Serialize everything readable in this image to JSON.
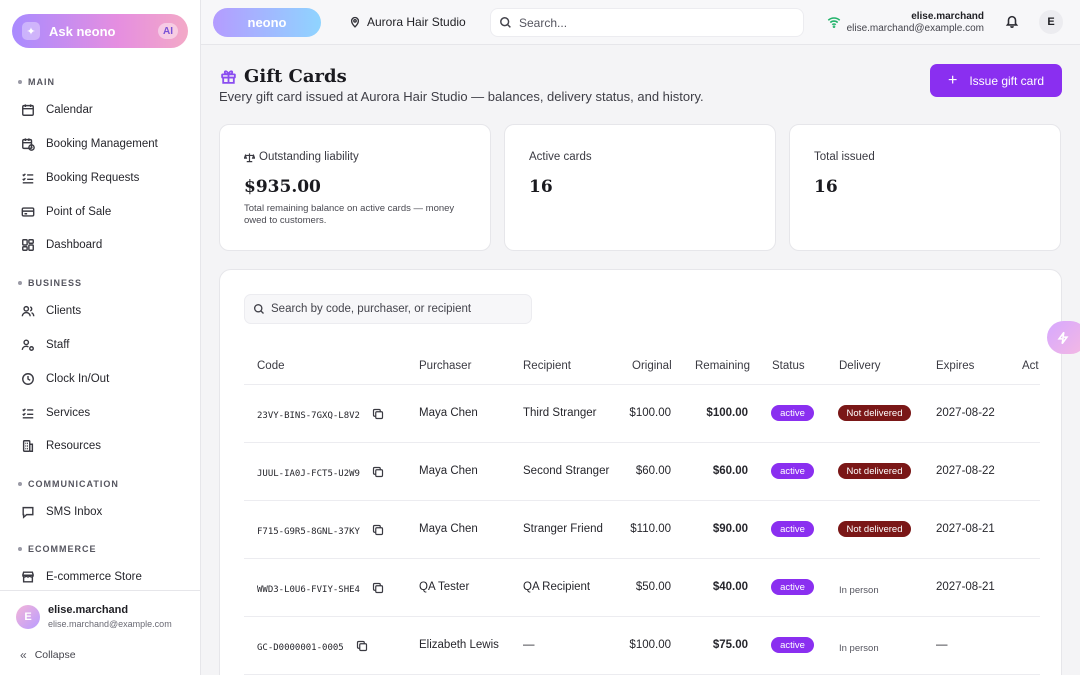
{
  "sidebar": {
    "ask": {
      "label": "Ask neono",
      "badge": "AI"
    },
    "sections": [
      {
        "label": "MAIN"
      },
      {
        "label": "BUSINESS"
      },
      {
        "label": "COMMUNICATION"
      },
      {
        "label": "ECOMMERCE"
      }
    ],
    "items": [
      {
        "label": "Calendar",
        "icon": "calendar-icon"
      },
      {
        "label": "Booking Management",
        "icon": "calendar-clock-icon"
      },
      {
        "label": "Booking Requests",
        "icon": "list-check-icon"
      },
      {
        "label": "Point of Sale",
        "icon": "credit-card-icon"
      },
      {
        "label": "Dashboard",
        "icon": "grid-icon"
      },
      {
        "label": "Clients",
        "icon": "users-icon"
      },
      {
        "label": "Staff",
        "icon": "staff-icon"
      },
      {
        "label": "Clock In/Out",
        "icon": "clock-icon"
      },
      {
        "label": "Services",
        "icon": "list-icon"
      },
      {
        "label": "Resources",
        "icon": "building-icon"
      },
      {
        "label": "SMS Inbox",
        "icon": "message-icon"
      },
      {
        "label": "E-commerce Store",
        "icon": "store-icon"
      }
    ],
    "user": {
      "initial": "E",
      "name": "elise.marchand",
      "email": "elise.marchand@example.com"
    },
    "collapse_label": "Collapse"
  },
  "topbar": {
    "logo": "neono",
    "studio": "Aurora Hair Studio",
    "search_placeholder": "Search...",
    "user_name": "elise.marchand",
    "user_email": "elise.marchand@example.com",
    "avatar_initial": "E"
  },
  "page": {
    "title": "Gift Cards",
    "subtitle": "Every gift card issued at Aurora Hair Studio — balances, delivery status, and history.",
    "issue_button": "Issue gift card"
  },
  "stats": [
    {
      "label": "Outstanding liability",
      "value": "$935.00",
      "note": "Total remaining balance on active cards — money owed to customers."
    },
    {
      "label": "Active cards",
      "value": "16"
    },
    {
      "label": "Total issued",
      "value": "16"
    }
  ],
  "table": {
    "search_placeholder": "Search by code, purchaser, or recipient",
    "columns": [
      "Code",
      "Purchaser",
      "Recipient",
      "Original",
      "Remaining",
      "Status",
      "Delivery",
      "Expires",
      "Act"
    ],
    "rows": [
      {
        "code": "23VY-BINS-7GXQ-L8V2",
        "purchaser": "Maya Chen",
        "recipient": "Third Stranger",
        "original": "$100.00",
        "remaining": "$100.00",
        "status": "active",
        "delivery": "Not delivered",
        "expires": "2027-08-22"
      },
      {
        "code": "JUUL-IA0J-FCT5-U2W9",
        "purchaser": "Maya Chen",
        "recipient": "Second Stranger",
        "original": "$60.00",
        "remaining": "$60.00",
        "status": "active",
        "delivery": "Not delivered",
        "expires": "2027-08-22"
      },
      {
        "code": "F715-G9R5-8GNL-37KY",
        "purchaser": "Maya Chen",
        "recipient": "Stranger Friend",
        "original": "$110.00",
        "remaining": "$90.00",
        "status": "active",
        "delivery": "Not delivered",
        "expires": "2027-08-21"
      },
      {
        "code": "WWD3-L0U6-FVIY-SHE4",
        "purchaser": "QA Tester",
        "recipient": "QA Recipient",
        "original": "$50.00",
        "remaining": "$40.00",
        "status": "active",
        "delivery": "In person",
        "expires": "2027-08-21"
      },
      {
        "code": "GC-D0000001-0005",
        "purchaser": "Elizabeth Lewis",
        "recipient": "—",
        "original": "$100.00",
        "remaining": "$75.00",
        "status": "active",
        "delivery": "In person",
        "expires": "—"
      }
    ]
  },
  "colors": {
    "accent": "#8a2ff0",
    "not_delivered": "#7a1717",
    "online": "#22b36b"
  }
}
